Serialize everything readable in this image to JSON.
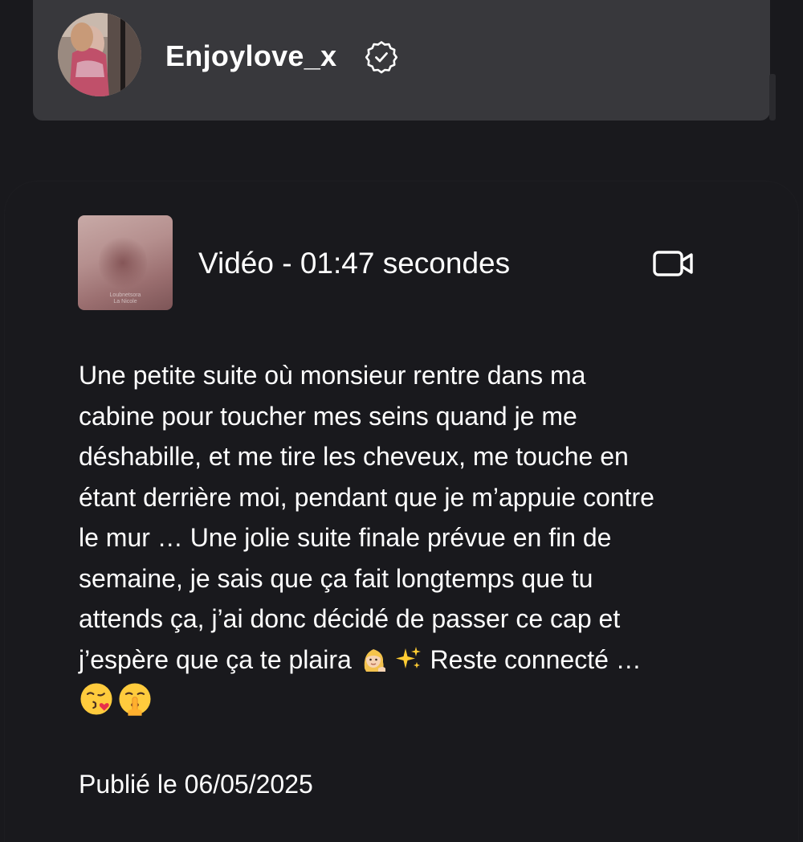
{
  "profile": {
    "username": "Enjoylove_x",
    "verified_icon": "verified-badge-icon"
  },
  "post": {
    "media": {
      "type_icon": "video-camera-icon",
      "label": "Vidéo - 01:47 secondes",
      "thumbnail_watermark": "Loubnetsora\nLa Nicole"
    },
    "description_lines": [
      "Une petite suite où monsieur rentre dans ma",
      "cabine pour toucher mes seins quand je me",
      "déshabille, et me tire les cheveux, me touche en",
      "étant derrière moi, pendant que je m’appuie contre",
      "le mur … Une jolie suite finale prévue en fin de",
      "semaine, je sais que ça fait longtemps que tu",
      "attends ça, j’ai donc décidé de passer ce cap et"
    ],
    "description_line_8_start": "j’espère que ça te plaira ",
    "description_line_8_end": " Reste connecté …",
    "emojis": [
      "woman-blonde-emoji",
      "sparkles-emoji",
      "kissing-heart-emoji",
      "shushing-face-emoji"
    ],
    "published": "Publié le 06/05/2025"
  },
  "colors": {
    "background": "#19191d",
    "header_card": "#38383c",
    "text": "#ffffff"
  }
}
